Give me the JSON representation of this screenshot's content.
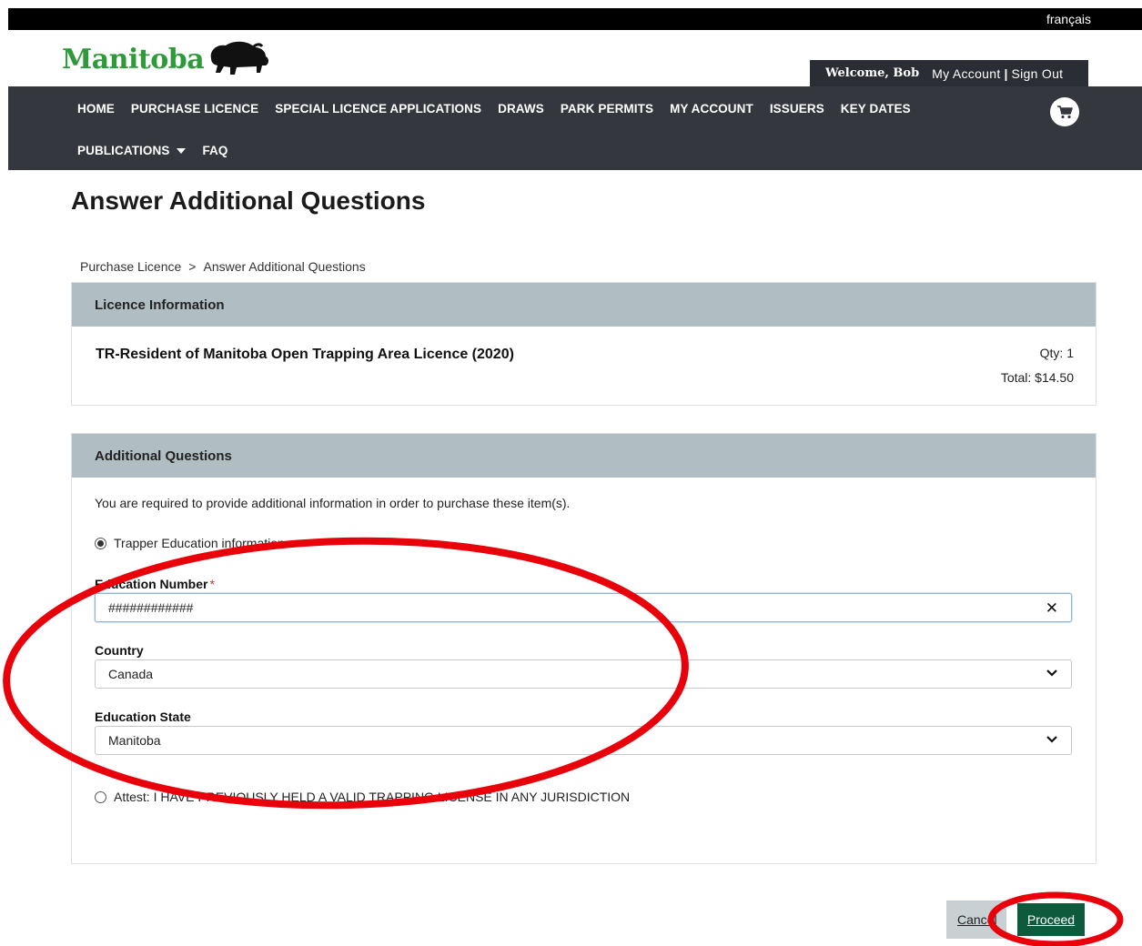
{
  "header": {
    "language_link": "français",
    "logo_text": "Manitoba",
    "welcome": "Welcome, Bob",
    "my_account": "My Account",
    "separator": "|",
    "sign_out": "Sign Out"
  },
  "nav": {
    "row1": [
      "HOME",
      "PURCHASE LICENCE",
      "SPECIAL LICENCE APPLICATIONS",
      "DRAWS",
      "PARK PERMITS",
      "MY ACCOUNT",
      "ISSUERS",
      "KEY DATES"
    ],
    "row2": [
      "PUBLICATIONS",
      "FAQ"
    ],
    "cart_icon": "cart-icon"
  },
  "page": {
    "title": "Answer Additional Questions",
    "breadcrumb": [
      "Purchase Licence",
      "Answer Additional Questions"
    ],
    "breadcrumb_separator": ">"
  },
  "licence_panel": {
    "heading": "Licence Information",
    "licence_name": "TR-Resident of Manitoba Open Trapping Area Licence (2020)",
    "qty": "Qty: 1",
    "total": "Total: $14.50"
  },
  "questions_panel": {
    "heading": "Additional Questions",
    "intro": "You are required to provide additional information in order to purchase these item(s).",
    "option_education": "Trapper Education information :",
    "education_number_label": "Education Number",
    "required_marker": "*",
    "education_number_value": "############",
    "country_label": "Country",
    "country_value": "Canada",
    "state_label": "Education State",
    "state_value": "Manitoba",
    "option_attest": "Attest: I HAVE PREVIOUSLY HELD A VALID TRAPPING LICENSE IN ANY JURISDICTION"
  },
  "actions": {
    "cancel": "Cancel",
    "proceed": "Proceed"
  },
  "colors": {
    "brand_green": "#2e9a3a",
    "nav_bg": "#34383e",
    "panel_head": "#b0bec3",
    "proceed_bg": "#0d5a3c",
    "annotation_red": "#e8000a"
  }
}
